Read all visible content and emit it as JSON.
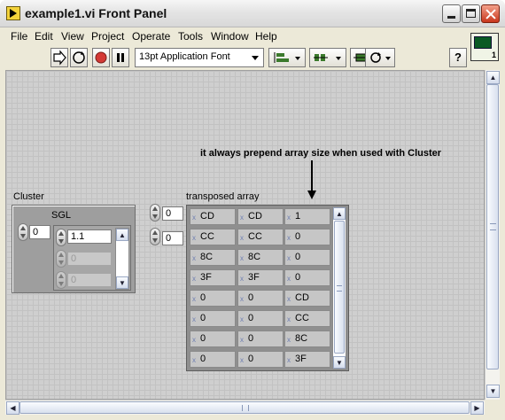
{
  "window": {
    "title": "example1.vi Front Panel"
  },
  "menu": [
    "File",
    "Edit",
    "View",
    "Project",
    "Operate",
    "Tools",
    "Window",
    "Help"
  ],
  "toolbar": {
    "font_select": "13pt Application Font",
    "help_label": "?"
  },
  "vi_icon": {
    "number": "1"
  },
  "annotation": "it always prepend array size when used with Cluster",
  "cluster": {
    "label": "Cluster",
    "index": "0",
    "inner_label": "SGL",
    "inner_index": "0",
    "values": [
      "1.1",
      "0",
      "0"
    ]
  },
  "transposed": {
    "label": "transposed array",
    "row_index": "0",
    "col_index": "0",
    "rows": [
      [
        "CD",
        "CD",
        "1"
      ],
      [
        "CC",
        "CC",
        "0"
      ],
      [
        "8C",
        "8C",
        "0"
      ],
      [
        "3F",
        "3F",
        "0"
      ],
      [
        "0",
        "0",
        "CD"
      ],
      [
        "0",
        "0",
        "CC"
      ],
      [
        "0",
        "0",
        "8C"
      ],
      [
        "0",
        "0",
        "3F"
      ]
    ],
    "cell_prefix": "x"
  }
}
